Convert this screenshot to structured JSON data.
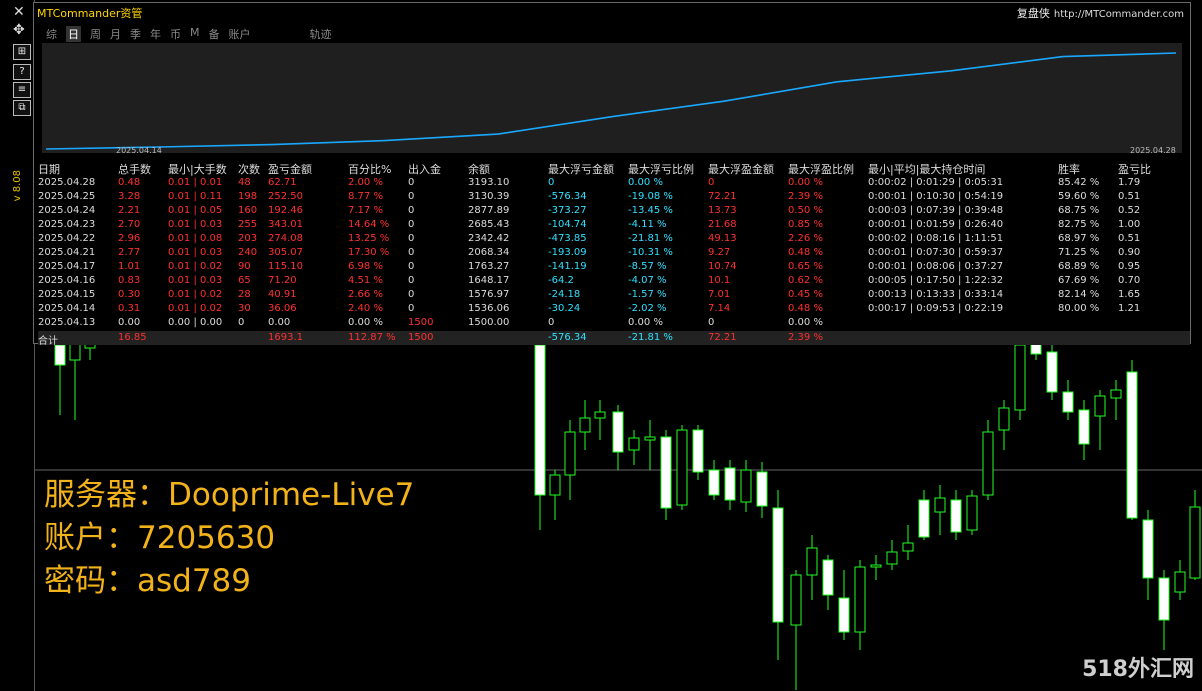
{
  "panel": {
    "title": "MTCommander资管",
    "brand": "复盘侠",
    "url": "http://MTCommander.com",
    "tabs": [
      "综",
      "日",
      "周",
      "月",
      "季",
      "年",
      "币",
      "M",
      "备",
      "账户"
    ],
    "active_tab": "日",
    "track_label": "轨迹",
    "equity_start_date": "2025.04.14",
    "equity_end_date": "2025.04.28",
    "line_color": "#1aa8ff",
    "headers": [
      "日期",
      "总手数",
      "最小|大手数",
      "次数",
      "盈亏金额",
      "百分比%",
      "出入金",
      "余额",
      "最大浮亏金额",
      "最大浮亏比例",
      "最大浮盈金额",
      "最大浮盈比例",
      "最小|平均|最大持仓时间",
      "胜率",
      "盈亏比"
    ],
    "rows": [
      [
        "2025.04.28",
        "0.48",
        "0.01 | 0.01",
        "48",
        "62.71",
        "2.00 %",
        "0",
        "3193.10",
        "0",
        "0.00 %",
        "0",
        "0.00 %",
        "0:00:02 | 0:01:29 | 0:05:31",
        "85.42 %",
        "1.79"
      ],
      [
        "2025.04.25",
        "3.28",
        "0.01 | 0.11",
        "198",
        "252.50",
        "8.77 %",
        "0",
        "3130.39",
        "-576.34",
        "-19.08 %",
        "72.21",
        "2.39 %",
        "0:00:01 | 0:10:30 | 0:54:19",
        "59.60 %",
        "0.51"
      ],
      [
        "2025.04.24",
        "2.21",
        "0.01 | 0.05",
        "160",
        "192.46",
        "7.17 %",
        "0",
        "2877.89",
        "-373.27",
        "-13.45 %",
        "13.73",
        "0.50 %",
        "0:00:03 | 0:07:39 | 0:39:48",
        "68.75 %",
        "0.52"
      ],
      [
        "2025.04.23",
        "2.70",
        "0.01 | 0.03",
        "255",
        "343.01",
        "14.64 %",
        "0",
        "2685.43",
        "-104.74",
        "-4.11 %",
        "21.68",
        "0.85 %",
        "0:00:01 | 0:01:59 | 0:26:40",
        "82.75 %",
        "1.00"
      ],
      [
        "2025.04.22",
        "2.96",
        "0.01 | 0.08",
        "203",
        "274.08",
        "13.25 %",
        "0",
        "2342.42",
        "-473.85",
        "-21.81 %",
        "49.13",
        "2.26 %",
        "0:00:02 | 0:08:16 | 1:11:51",
        "68.97 %",
        "0.51"
      ],
      [
        "2025.04.21",
        "2.77",
        "0.01 | 0.03",
        "240",
        "305.07",
        "17.30 %",
        "0",
        "2068.34",
        "-193.09",
        "-10.31 %",
        "9.27",
        "0.48 %",
        "0:00:01 | 0:07:30 | 0:59:37",
        "71.25 %",
        "0.90"
      ],
      [
        "2025.04.17",
        "1.01",
        "0.01 | 0.02",
        "90",
        "115.10",
        "6.98 %",
        "0",
        "1763.27",
        "-141.19",
        "-8.57 %",
        "10.74",
        "0.65 %",
        "0:00:01 | 0:08:06 | 0:37:27",
        "68.89 %",
        "0.95"
      ],
      [
        "2025.04.16",
        "0.83",
        "0.01 | 0.03",
        "65",
        "71.20",
        "4.51 %",
        "0",
        "1648.17",
        "-64.2",
        "-4.07 %",
        "10.1",
        "0.62 %",
        "0:00:05 | 0:17:50 | 1:22:32",
        "67.69 %",
        "0.70"
      ],
      [
        "2025.04.15",
        "0.30",
        "0.01 | 0.02",
        "28",
        "40.91",
        "2.66 %",
        "0",
        "1576.97",
        "-24.18",
        "-1.57 %",
        "7.01",
        "0.45 %",
        "0:00:13 | 0:13:33 | 0:33:14",
        "82.14 %",
        "1.65"
      ],
      [
        "2025.04.14",
        "0.31",
        "0.01 | 0.02",
        "30",
        "36.06",
        "2.40 %",
        "0",
        "1536.06",
        "-30.24",
        "-2.02 %",
        "7.14",
        "0.48 %",
        "0:00:17 | 0:09:53 | 0:22:19",
        "80.00 %",
        "1.21"
      ],
      [
        "2025.04.13",
        "0.00",
        "0.00 | 0.00",
        "0",
        "0.00",
        "0.00 %",
        "1500",
        "1500.00",
        "0",
        "0.00 %",
        "0",
        "0.00 %",
        "",
        "",
        ""
      ]
    ],
    "total": [
      "合计",
      "16.85",
      "",
      "",
      "1693.1",
      "112.87 %",
      "1500",
      "",
      "-576.34",
      "-21.81 %",
      "72.21",
      "2.39 %",
      "",
      "",
      ""
    ]
  },
  "side_label": "v 8.08",
  "credentials": {
    "server": "服务器：Dooprime-Live7",
    "account": "账户：7205630",
    "password": "密码：asd789"
  },
  "watermark": "518外汇网"
}
